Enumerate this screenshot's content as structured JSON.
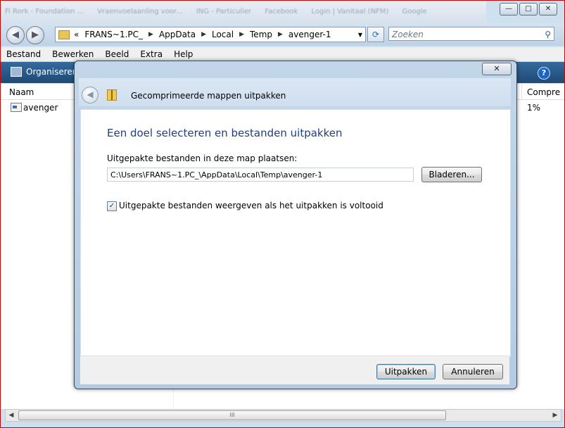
{
  "background_tabs": [
    "Fi Rork - Foundation ...",
    "Vraenvoelaanling voor...",
    "ING - Particulier",
    "Facebook",
    "Login | Vanitaal (NFM)",
    "Google"
  ],
  "address_bar": {
    "prefix": "«",
    "crumbs": [
      "FRANS~1.PC_",
      "AppData",
      "Local",
      "Temp",
      "avenger-1"
    ]
  },
  "search": {
    "placeholder": "Zoeken"
  },
  "menu": [
    "Bestand",
    "Bewerken",
    "Beeld",
    "Extra",
    "Help"
  ],
  "commandbar": {
    "organise_label": "Organiseren",
    "help_label": "?"
  },
  "filelist": {
    "columns": {
      "name": "Naam",
      "compression": "Compre"
    },
    "rows": [
      {
        "name": "avenger",
        "compression": "1%"
      }
    ]
  },
  "scrollbar": {
    "grip": "III"
  },
  "window_controls": {
    "minimize": "—",
    "maximize": "□",
    "close": "✕"
  },
  "dialog": {
    "title": "Gecomprimeerde mappen uitpakken",
    "close_label": "✕",
    "instruction": "Een doel selecteren en bestanden uitpakken",
    "dest_label": "Uitgepakte bestanden in deze map plaatsen:",
    "dest_path": "C:\\Users\\FRANS~1.PC_\\AppData\\Local\\Temp\\avenger-1",
    "browse_label": "Bladeren...",
    "show_files_label": "Uitgepakte bestanden weergeven als het uitpakken is voltooid",
    "show_files_checked": true,
    "extract_label": "Uitpakken",
    "cancel_label": "Annuleren"
  }
}
